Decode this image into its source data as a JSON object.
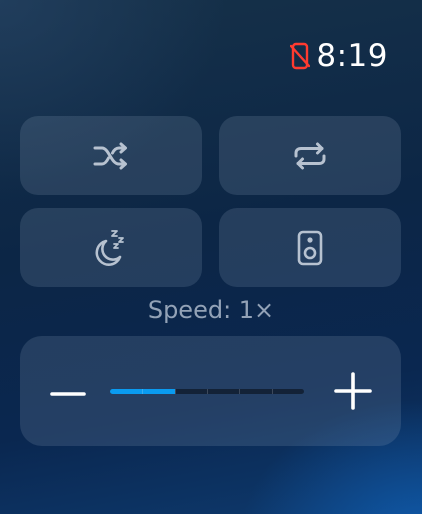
{
  "status_bar": {
    "time": "8:19",
    "connection_icon": "phone-disconnected-icon",
    "connection_icon_color": "#ff3b30"
  },
  "controls": [
    {
      "id": "shuffle",
      "icon": "shuffle-icon"
    },
    {
      "id": "repeat",
      "icon": "repeat-icon"
    },
    {
      "id": "sleep-timer",
      "icon": "moon-zzz-icon"
    },
    {
      "id": "audio-output",
      "icon": "speaker-icon"
    }
  ],
  "speed": {
    "label": "Speed: 1×",
    "level_segments": 2,
    "total_segments": 6,
    "decrease_icon": "minus-icon",
    "increase_icon": "plus-icon"
  },
  "colors": {
    "accent": "#0a9bf0",
    "icon": "#b7c2d0",
    "alert": "#ff3b30"
  }
}
